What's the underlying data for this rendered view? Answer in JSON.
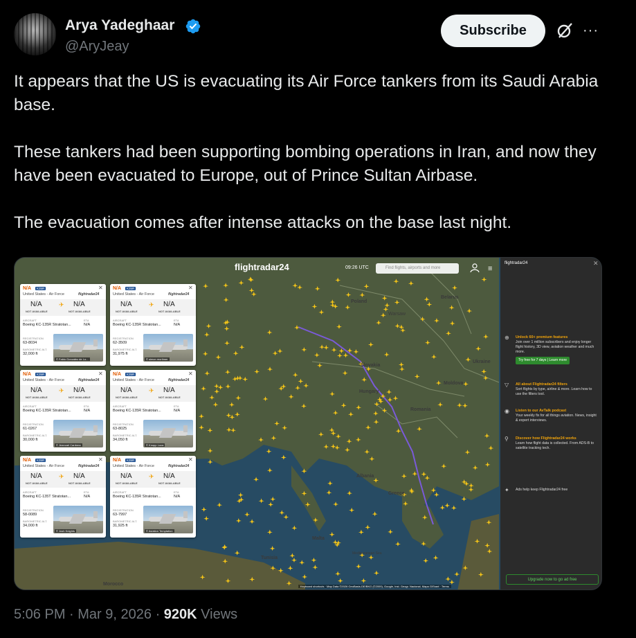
{
  "author": {
    "display_name": "Arya Yadeghaar",
    "handle": "@AryJeay",
    "verified": true,
    "verified_color": "#1d9bf0"
  },
  "actions": {
    "subscribe_label": "Subscribe",
    "grok_icon": "grok-icon",
    "more_label": "···"
  },
  "tweet": {
    "paragraphs": [
      "It appears that the US is evacuating its Air Force tankers from its Saudi Arabia base.",
      "These tankers had been supporting bombing operations in Iran, and now they have been evacuated to Europe, out of Prince Sultan Airbase.",
      "The evacuation comes after intense attacks on the base last night."
    ]
  },
  "media": {
    "app": {
      "logo": "flightradar24",
      "time": "09:26 UTC",
      "search_placeholder": "Find flights, airports and more",
      "login_label": "LOG IN"
    },
    "map_labels": {
      "poland": "Poland",
      "belarus": "Belarus",
      "ukraine": "Ukraine",
      "warsaw": "Warsaw",
      "moldova": "Moldova",
      "romania": "Romania",
      "hungary": "Hungary",
      "slovakia": "Slovakia",
      "albania": "Albania",
      "greece": "Greece",
      "malta": "Malta",
      "tunisia": "Tunisia",
      "morocco": "Morocco",
      "mediterranean": "Mediterranean Sea"
    },
    "cards": [
      {
        "callsign": "N/A",
        "badge": "K35R",
        "airline": "United States - Air Force",
        "brand": "flightradar24",
        "from": "N/A",
        "to": "N/A",
        "from_sub": "NOT AVAILABLE",
        "to_sub": "NOT AVAILABLE",
        "aircraft_label": "AIRCRAFT",
        "aircraft": "Boeing KC-135R Stratotan...",
        "eta_label": "ETA",
        "eta": "N/A",
        "reg_label": "REGISTRATION",
        "registration": "63-8034",
        "alt_label": "BAROMETRIC ALT.",
        "altitude": "32,000 ft",
        "credit": "© Fabio Gonzalez de Lo..."
      },
      {
        "callsign": "N/A",
        "badge": "K35R",
        "airline": "United States - Air Force",
        "brand": "flightradar24",
        "from": "N/A",
        "to": "N/A",
        "from_sub": "NOT AVAILABLE",
        "to_sub": "NOT AVAILABLE",
        "aircraft_label": "AIRCRAFT",
        "aircraft": "Boeing KC-135R Stratotan...",
        "eta_label": "ETA",
        "eta": "N/A",
        "reg_label": "REGISTRATION",
        "registration": "62-3509",
        "alt_label": "BAROMETRIC ALT.",
        "altitude": "31,975 ft",
        "credit": "© simon mortimer"
      },
      {
        "callsign": "N/A",
        "badge": "K35R",
        "airline": "United States - Air Force",
        "brand": "flightradar24",
        "from": "N/A",
        "to": "N/A",
        "from_sub": "NOT AVAILABLE",
        "to_sub": "NOT AVAILABLE",
        "aircraft_label": "AIRCRAFT",
        "aircraft": "Boeing KC-135R Stratotan...",
        "eta_label": "ETA",
        "eta": "N/A",
        "reg_label": "REGISTRATION",
        "registration": "61-0267",
        "alt_label": "BAROMETRIC ALT.",
        "altitude": "30,000 ft",
        "credit": "© Jeancarl Cardona"
      },
      {
        "callsign": "N/A",
        "badge": "K35R",
        "airline": "United States - Air Force",
        "brand": "flightradar24",
        "from": "N/A",
        "to": "N/A",
        "from_sub": "NOT AVAILABLE",
        "to_sub": "NOT AVAILABLE",
        "aircraft_label": "AIRCRAFT",
        "aircraft": "Boeing KC-135R Stratotan...",
        "eta_label": "ETA",
        "eta": "N/A",
        "reg_label": "REGISTRATION",
        "registration": "63-8025",
        "alt_label": "BAROMETRIC ALT.",
        "altitude": "34,050 ft",
        "credit": "© Knopp Luca"
      },
      {
        "callsign": "N/A",
        "badge": "K35R",
        "airline": "United States - Air Force",
        "brand": "flightradar24",
        "from": "N/A",
        "to": "N/A",
        "from_sub": "NOT AVAILABLE",
        "to_sub": "NOT AVAILABLE",
        "aircraft_label": "AIRCRAFT",
        "aircraft": "Boeing KC-135T Stratotan...",
        "eta_label": "ETA",
        "eta": "N/A",
        "reg_label": "REGISTRATION",
        "registration": "58-0089",
        "alt_label": "BAROMETRIC ALT.",
        "altitude": "34,000 ft",
        "credit": "© Josh Knights"
      },
      {
        "callsign": "N/A",
        "badge": "K35R",
        "airline": "United States - Air Force",
        "brand": "flightradar24",
        "from": "N/A",
        "to": "N/A",
        "from_sub": "NOT AVAILABLE",
        "to_sub": "NOT AVAILABLE",
        "aircraft_label": "AIRCRAFT",
        "aircraft": "Boeing KC-135R Stratotan...",
        "eta_label": "ETA",
        "eta": "N/A",
        "reg_label": "REGISTRATION",
        "registration": "63-7997",
        "alt_label": "BAROMETRIC ALT.",
        "altitude": "31,925 ft",
        "credit": "© Aviation Temptation"
      }
    ],
    "sidebar": {
      "top": "flightradar24",
      "blocks": [
        {
          "title": "Unlock 60+ premium features",
          "text": "Join over 1 million subscribers and enjoy longer flight history, 3D view, aviation weather and much more.",
          "button": "Try free for 7 days | Learn more"
        },
        {
          "title": "All about Flightradar24 filters",
          "text": "Sort flights by type, airline & more. Learn how to use the filters tool."
        },
        {
          "title": "Listen to our AvTalk podcast",
          "text": "Your weekly fix for all things aviation. News, insight & expert interviews."
        },
        {
          "title": "Discover how Flightradar24 works",
          "text": "Learn how flight data is collected. From ADS-B to satellite tracking tech."
        },
        {
          "title": "",
          "text": "Ads help keep Flightradar24 free"
        }
      ],
      "upgrade": "Upgrade now to go ad free"
    },
    "attribution": "Keyboard shortcuts · Map Data ©2026 GeoBasis-DE/BKG (©2009), Google, Inst. Geogr. Nacional, Mapa GISrael · Terms"
  },
  "footer": {
    "time": "5:06 PM",
    "date": "Mar 9, 2026",
    "views_count": "920K",
    "views_label": "Views"
  }
}
